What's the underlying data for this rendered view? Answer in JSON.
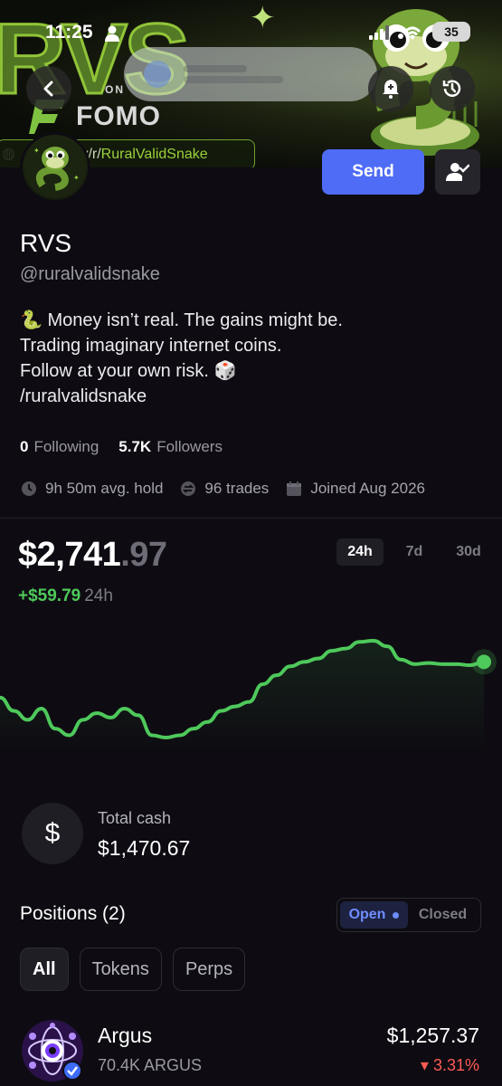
{
  "status_bar": {
    "time": "11:25",
    "battery": "35"
  },
  "banner": {
    "big_text": "RVS",
    "on_text": "ON",
    "brand": "FOMO",
    "url_prefix": "/y/r/",
    "url_name": "RuralValidSnake"
  },
  "profile": {
    "name": "RVS",
    "handle": "@ruralvalidsnake",
    "bio_lines": [
      "🐍 Money isn’t real. The gains might be.",
      "Trading imaginary internet coins.",
      "Follow at your own risk. 🎲",
      "/ruralvalidsnake"
    ],
    "following_count": "0",
    "following_label": "Following",
    "followers_count": "5.7K",
    "followers_label": "Followers",
    "avg_hold": "9h 50m avg. hold",
    "trades": "96 trades",
    "joined": "Joined Aug 2026"
  },
  "actions": {
    "send_label": "Send"
  },
  "portfolio": {
    "value_dollars": "$2,741",
    "value_cents": ".97",
    "change": "+$59.79",
    "change_period": "24h",
    "ranges": [
      "24h",
      "7d",
      "30d"
    ],
    "active_range": "24h"
  },
  "chart_data": {
    "type": "line",
    "title": "",
    "xlabel": "",
    "ylabel": "",
    "x": [
      0,
      1,
      2,
      3,
      4,
      5,
      6,
      7,
      8,
      9,
      10,
      11,
      12,
      13,
      14,
      15,
      16,
      17,
      18,
      19,
      20,
      21,
      22,
      23,
      24,
      25,
      26,
      27,
      28,
      29,
      30,
      31,
      32,
      33,
      34,
      35
    ],
    "values": [
      2710,
      2698,
      2690,
      2700,
      2682,
      2676,
      2690,
      2696,
      2692,
      2700,
      2694,
      2676,
      2674,
      2676,
      2682,
      2688,
      2698,
      2702,
      2706,
      2722,
      2730,
      2738,
      2742,
      2745,
      2752,
      2754,
      2760,
      2761,
      2756,
      2744,
      2740,
      2741,
      2740,
      2740,
      2739,
      2742
    ],
    "series_color": "#4ec95b"
  },
  "cash": {
    "label": "Total cash",
    "value": "$1,470.67",
    "icon": "dollar-sign"
  },
  "positions": {
    "title": "Positions (2)",
    "toggle": [
      "Open",
      "Closed"
    ],
    "filters": [
      "All",
      "Tokens",
      "Perps"
    ],
    "items": [
      {
        "name": "Argus",
        "quantity": "70.4K ARGUS",
        "value": "$1,257.37",
        "change": "3.31%",
        "direction": "down"
      }
    ]
  },
  "colors": {
    "accent": "#4f6cf7",
    "up": "#4ec95b",
    "down": "#ff5a55",
    "background": "#0e0c12"
  }
}
